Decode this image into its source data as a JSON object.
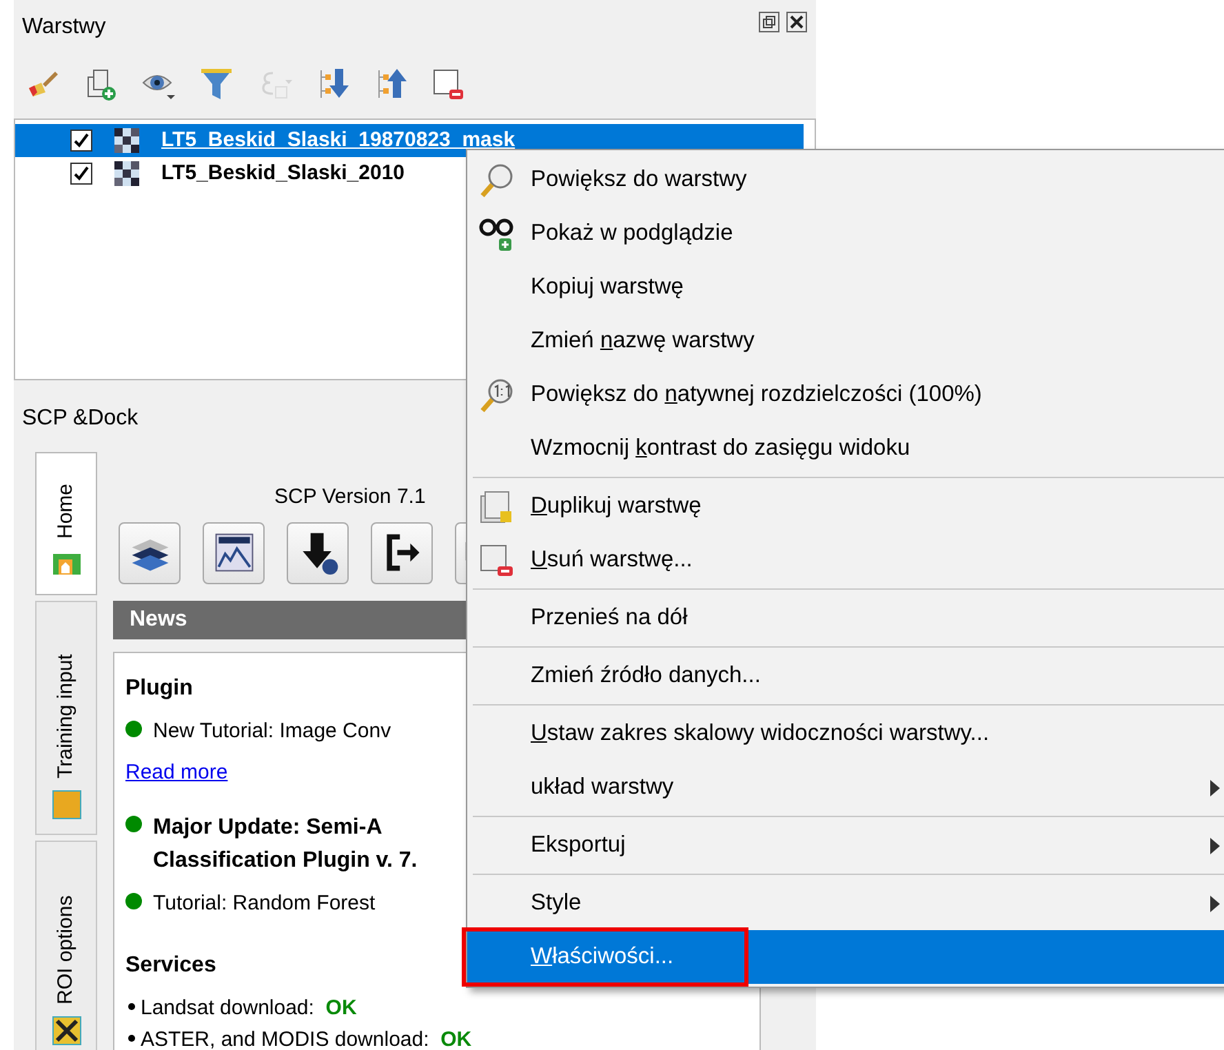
{
  "layers_panel": {
    "title": "Warstwy",
    "toolbar": [
      {
        "kind": "brush",
        "disabled": false
      },
      {
        "kind": "addgroup",
        "disabled": false
      },
      {
        "kind": "eye",
        "disabled": false
      },
      {
        "kind": "filter",
        "disabled": false
      },
      {
        "kind": "expression",
        "disabled": true
      },
      {
        "kind": "expand",
        "disabled": false
      },
      {
        "kind": "collapse",
        "disabled": false
      },
      {
        "kind": "remove",
        "disabled": false
      }
    ],
    "layers": [
      {
        "name": "LT5_Beskid_Slaski_19870823_mask",
        "checked": true,
        "selected": true
      },
      {
        "name": "LT5_Beskid_Slaski_2010",
        "checked": true,
        "selected": false
      }
    ]
  },
  "dock": {
    "title": "SCP &Dock",
    "tabs": [
      {
        "label": "Home",
        "kind": "home",
        "selected": true
      },
      {
        "label": "Training input",
        "kind": "square",
        "selected": false
      },
      {
        "label": "ROI options",
        "kind": "tools",
        "selected": false
      }
    ],
    "version": "SCP Version 7.1",
    "tools": [
      {
        "kind": "layers"
      },
      {
        "kind": "spectral"
      },
      {
        "kind": "download"
      },
      {
        "kind": "export"
      },
      {
        "kind": "partial"
      }
    ],
    "news": {
      "title": "News",
      "sections": [
        {
          "heading": "Plugin",
          "items": [
            {
              "lines": [
                "New Tutorial: Image Conv"
              ],
              "bold": false,
              "link": "Read more"
            },
            {
              "lines": [
                "Major Update: Semi-A",
                "Classification Plugin v. 7."
              ],
              "bold": true
            },
            {
              "lines": [
                "Tutorial: Random Forest"
              ],
              "bold": false
            }
          ]
        },
        {
          "heading": "Services",
          "status": [
            {
              "label": "Landsat download: ",
              "value": "OK",
              "ok": true
            },
            {
              "label": "ASTER, and MODIS download: ",
              "value": "OK",
              "ok": true
            }
          ]
        }
      ]
    }
  },
  "context_menu": {
    "groups": [
      [
        {
          "kind": "zoom",
          "pre": "Powiększ do warstwy",
          "selected": false
        },
        {
          "kind": "glasses",
          "pre": "Pokaż w podglądzie",
          "selected": false
        },
        {
          "pre": "Kopiuj warstwę",
          "selected": false
        },
        {
          "pre": "Zmień ",
          "key": "n",
          "post": "azwę warstwy",
          "selected": false
        },
        {
          "kind": "zoom11",
          "pre": "Powiększ do ",
          "key": "n",
          "post": "atywnej rozdzielczości (100%)",
          "selected": false
        },
        {
          "pre": "Wzmocnij ",
          "key": "k",
          "post": "ontrast do zasięgu widoku",
          "selected": false
        }
      ],
      [
        {
          "kind": "duplicate",
          "key": "D",
          "post": "uplikuj warstwę",
          "selected": false
        },
        {
          "kind": "remove",
          "key": "U",
          "post": "suń warstwę...",
          "selected": false
        }
      ],
      [
        {
          "pre": "Przenieś na dół",
          "selected": false
        }
      ],
      [
        {
          "pre": "Zmień źródło danych...",
          "selected": false
        }
      ],
      [
        {
          "key": "U",
          "post": "staw zakres skalowy widoczności warstwy...",
          "selected": false
        },
        {
          "pre": "układ warstwy",
          "submenu": true,
          "selected": false
        }
      ],
      [
        {
          "pre": "Eksportuj",
          "submenu": true,
          "selected": false
        }
      ],
      [
        {
          "pre": "Style",
          "submenu": true,
          "selected": false
        },
        {
          "key": "W",
          "post": "łaściwości...",
          "selected": true,
          "highlighted": true
        }
      ]
    ]
  }
}
